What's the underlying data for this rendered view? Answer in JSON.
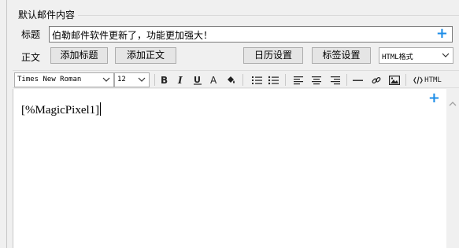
{
  "group": {
    "title": "默认邮件内容"
  },
  "subject": {
    "label": "标题",
    "value": "伯勒邮件软件更新了，功能更加强大！",
    "add_icon": "plus-icon"
  },
  "body": {
    "label": "正文",
    "add_title_label": "添加标题",
    "add_body_label": "添加正文",
    "calendar_label": "日历设置",
    "tag_label": "标签设置",
    "format_selected": "HTML格式"
  },
  "toolbar": {
    "font_family": "Times New Roman",
    "font_size": "12",
    "html_label": "HTML",
    "icons": [
      "bold-icon",
      "italic-icon",
      "underline-icon",
      "font-color-icon",
      "highlight-icon",
      "ordered-list-icon",
      "unordered-list-icon",
      "align-left-icon",
      "align-center-icon",
      "align-right-icon",
      "horizontal-rule-icon",
      "link-icon",
      "image-icon",
      "html-source-icon"
    ]
  },
  "editor": {
    "content": "[%MagicPixel1]",
    "add_icon": "plus-icon"
  },
  "colors": {
    "accent": "#1e8ee8"
  }
}
